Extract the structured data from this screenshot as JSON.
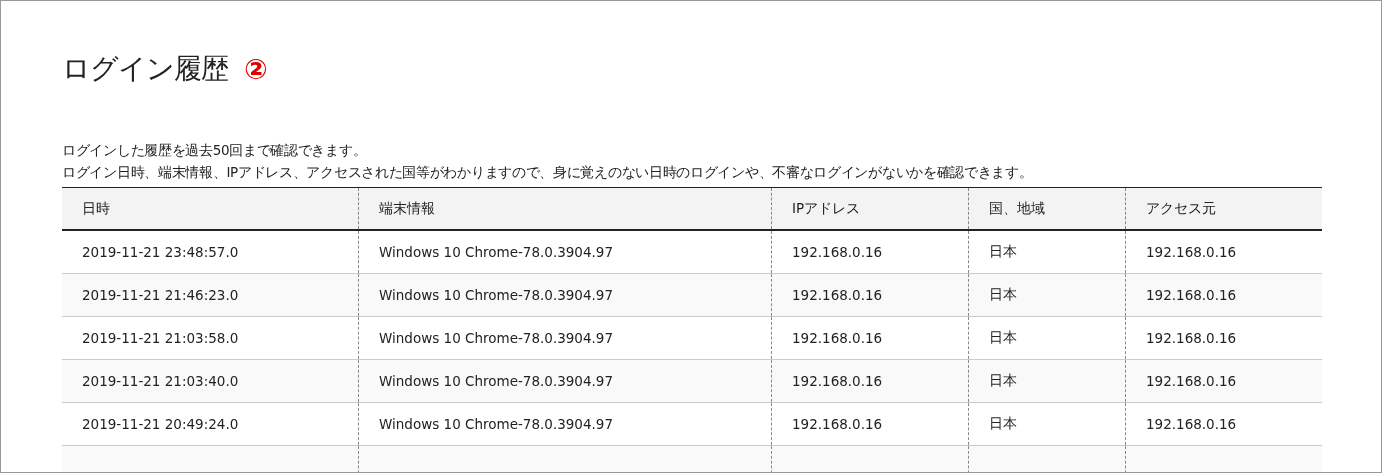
{
  "title": "ログイン履歴",
  "badge": "②",
  "description": [
    "ログインした履歴を過去50回まで確認できます。",
    "ログイン日時、端末情報、IPアドレス、アクセスされた国等がわかりますので、身に覚えのない日時のログインや、不審なログインがないかを確認できます。"
  ],
  "table": {
    "columns": [
      "日時",
      "端末情報",
      "IPアドレス",
      "国、地域",
      "アクセス元"
    ],
    "rows": [
      [
        "2019-11-21 23:48:57.0",
        "Windows 10 Chrome-78.0.3904.97",
        "192.168.0.16",
        "日本",
        "192.168.0.16"
      ],
      [
        "2019-11-21 21:46:23.0",
        "Windows 10 Chrome-78.0.3904.97",
        "192.168.0.16",
        "日本",
        "192.168.0.16"
      ],
      [
        "2019-11-21 21:03:58.0",
        "Windows 10 Chrome-78.0.3904.97",
        "192.168.0.16",
        "日本",
        "192.168.0.16"
      ],
      [
        "2019-11-21 21:03:40.0",
        "Windows 10 Chrome-78.0.3904.97",
        "192.168.0.16",
        "日本",
        "192.168.0.16"
      ],
      [
        "2019-11-21 20:49:24.0",
        "Windows 10 Chrome-78.0.3904.97",
        "192.168.0.16",
        "日本",
        "192.168.0.16"
      ]
    ]
  }
}
